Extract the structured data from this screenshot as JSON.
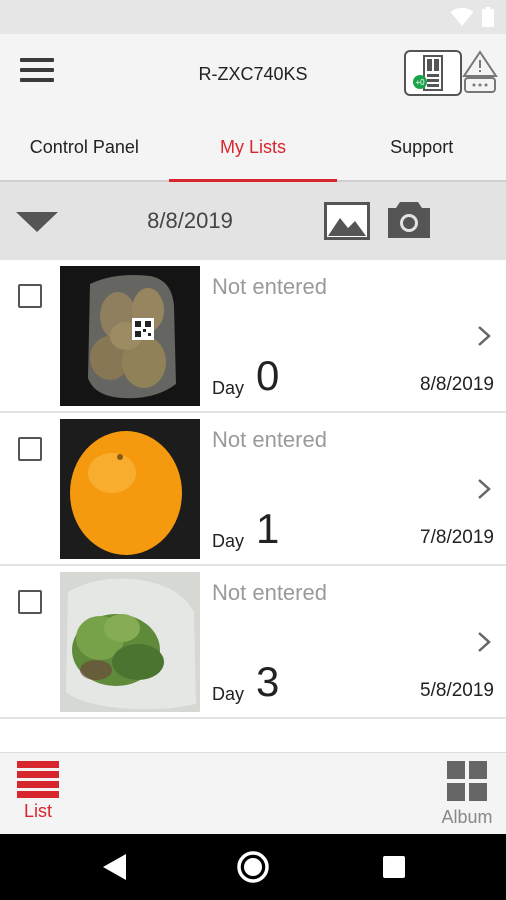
{
  "status_bar": {
    "icons": [
      "wifi-icon",
      "battery-icon"
    ]
  },
  "app_bar": {
    "title": "R-ZXC740KS",
    "icons": [
      "menu-icon",
      "fridge-status-icon",
      "alert-icon"
    ]
  },
  "tabs": [
    {
      "label": "Control Panel",
      "active": false
    },
    {
      "label": "My Lists",
      "active": true
    },
    {
      "label": "Support",
      "active": false
    }
  ],
  "date_bar": {
    "date": "8/8/2019",
    "icons": [
      "dropdown-caret-icon",
      "gallery-icon",
      "camera-icon"
    ]
  },
  "items": [
    {
      "name": "Not entered",
      "day_label": "Day",
      "day": "0",
      "date": "8/8/2019",
      "photo": "potatoes-in-bag"
    },
    {
      "name": "Not entered",
      "day_label": "Day",
      "day": "1",
      "date": "7/8/2019",
      "photo": "orange"
    },
    {
      "name": "Not entered",
      "day_label": "Day",
      "day": "3",
      "date": "5/8/2019",
      "photo": "lettuce-in-bag"
    }
  ],
  "bottom_nav": {
    "list_label": "List",
    "album_label": "Album"
  },
  "system_nav": {
    "icons": [
      "back-icon",
      "home-icon",
      "recents-icon"
    ]
  },
  "colors": {
    "accent": "#d8262e",
    "text": "#222222",
    "muted": "#9a9a9a"
  }
}
